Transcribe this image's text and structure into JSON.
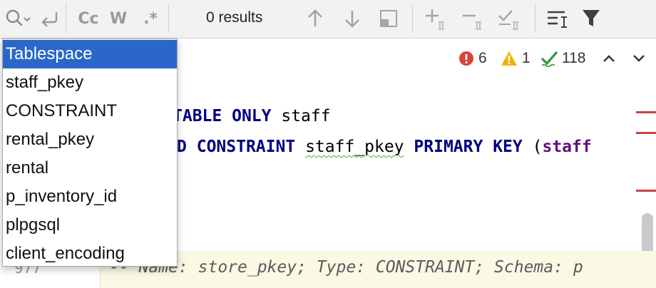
{
  "toolbar": {
    "results_label": "0 results",
    "match_case_label": "Cc",
    "whole_words_label": "W",
    "regex_label": ".*",
    "icons": [
      "search-history-icon",
      "replace-icon",
      "match-case-icon",
      "whole-words-icon",
      "regex-icon",
      "previous-occurrence-icon",
      "next-occurrence-icon",
      "search-in-selection-icon",
      "add-selection-icon",
      "remove-selection-icon",
      "select-all-occurrences-icon",
      "filter-settings-icon",
      "filter-icon"
    ]
  },
  "inspections": {
    "errors": "6",
    "warnings": "1",
    "ok": "118",
    "colors": {
      "error": "#d9443a",
      "warning": "#f0b400",
      "ok": "#3c9a3c"
    }
  },
  "editor": {
    "line1": {
      "kw1": "TABLE",
      "kw2": "ONLY",
      "id": "staff"
    },
    "line2": {
      "kw1": "D",
      "kw2": "CONSTRAINT",
      "id": "staff_pkey",
      "kw3": "PRIMARY",
      "kw4": "KEY",
      "paren": "(",
      "fld": "staff"
    },
    "comment": "-- Name: store_pkey; Type: CONSTRAINT; Schema: p",
    "line_number": "977"
  },
  "completion": {
    "selected_index": 0,
    "items": [
      "Tablespace",
      "staff_pkey",
      "CONSTRAINT",
      "rental_pkey",
      "rental",
      "p_inventory_id",
      "plpgsql",
      "client_encoding"
    ]
  }
}
